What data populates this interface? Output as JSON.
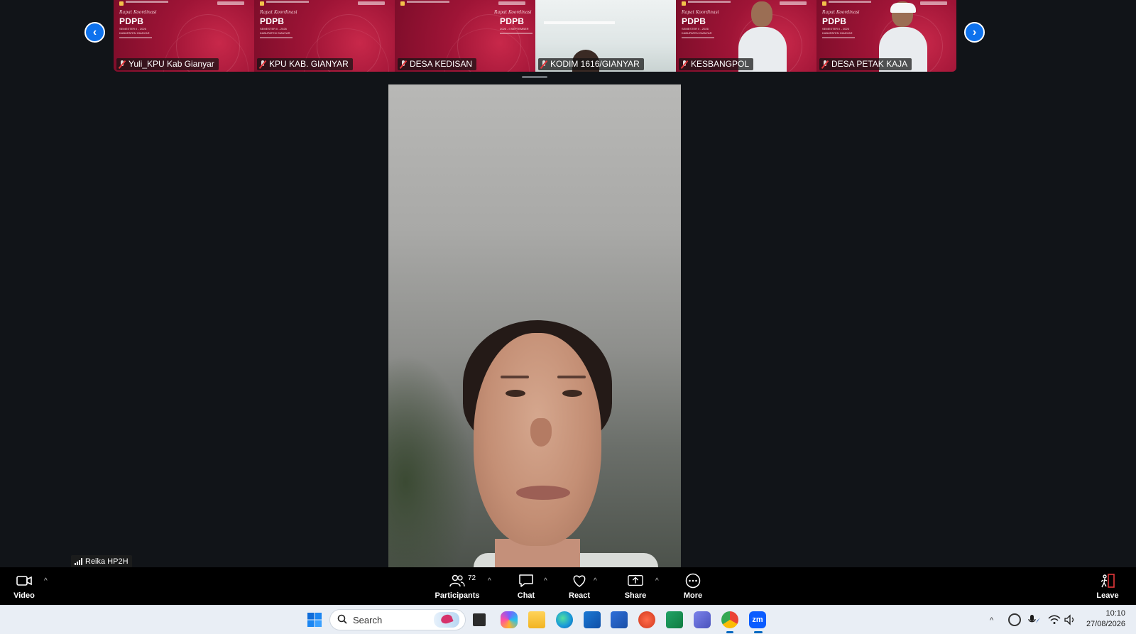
{
  "gallery": {
    "tiles": [
      {
        "name": "Yuli_KPU Kab Gianyar",
        "kind": "slide",
        "script": "Rapat Koordinasi",
        "title": "PDPB",
        "sub": "SEMESTER II - 2026 KABUPATEN GIANYAR"
      },
      {
        "name": "KPU KAB. GIANYAR",
        "kind": "slide",
        "script": "Rapat Koordinasi",
        "title": "PDPB",
        "sub": "SEMESTER II - 2026 KABUPATEN GIANYAR"
      },
      {
        "name": "DESA KEDISAN",
        "kind": "slide",
        "script": "Rapat Koordinasi",
        "title": "PDPB",
        "sub": "2026 - II SEPTEMBER"
      },
      {
        "name": "KODIM 1616/GIANYAR",
        "kind": "camera"
      },
      {
        "name": "KESBANGPOL",
        "kind": "slide-person",
        "script": "Rapat Koordinasi",
        "title": "PDPB",
        "sub": "SEMESTER II - 2026 KABUPATEN GIANYAR"
      },
      {
        "name": "DESA PETAK KAJA",
        "kind": "slide-person-cap",
        "script": "Rapat Koordinasi",
        "title": "PDPB",
        "sub": "SEMESTER II - 2026 KABUPATEN GIANYAR"
      }
    ]
  },
  "main": {
    "self_name": "Reika HP2H"
  },
  "toolbar": {
    "video_label": "Video",
    "participants_label": "Participants",
    "participants_count": "72",
    "chat_label": "Chat",
    "react_label": "React",
    "share_label": "Share",
    "more_label": "More",
    "leave_label": "Leave"
  },
  "taskbar": {
    "search_placeholder": "Search",
    "time": "10:10",
    "date": "27/08/2026"
  },
  "colors": {
    "zoom_blue": "#0e72ed",
    "slide_red": "#9e1436",
    "leave_red": "#e5383b"
  }
}
